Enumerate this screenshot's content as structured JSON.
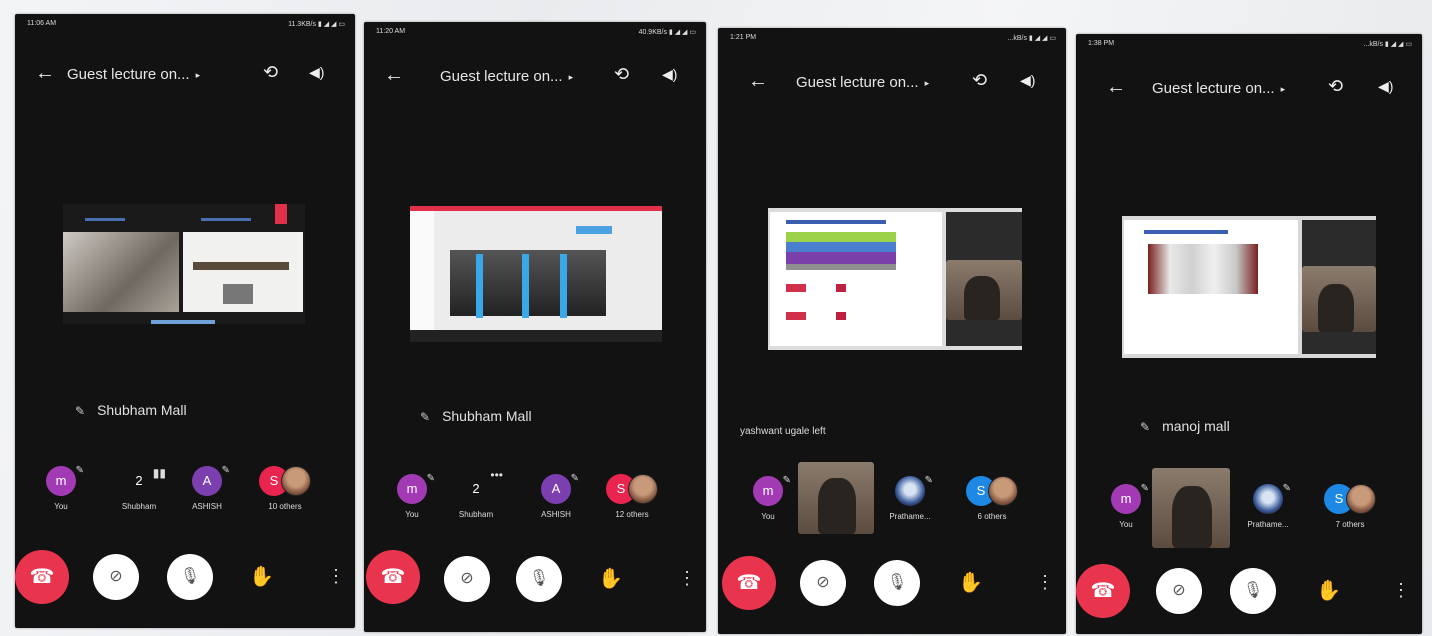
{
  "colors": {
    "end_call": "#e8344c",
    "avatar_m": "#a23bb3",
    "avatar_a": "#7b3fb0",
    "avatar_s": "#e8244f",
    "avatar_blue": "#1e88e5",
    "background": "#121213"
  },
  "phones": [
    {
      "status": {
        "time": "11:06 AM",
        "signal": "11.3KB/s ▮ ◢ ◢ ▭"
      },
      "header": {
        "back_icon": "←",
        "title": "Guest lecture on...",
        "caret": "▸",
        "switch_icon": "⟲",
        "speaker_icon": "◀)"
      },
      "speaker_name": "Shubham Mall",
      "participants": [
        {
          "initial": "m",
          "label": "You"
        },
        {
          "initial": "2",
          "label": "Shubham"
        },
        {
          "initial": "A",
          "label": "ASHISH"
        },
        {
          "initial": "S",
          "label": "10 others"
        }
      ]
    },
    {
      "status": {
        "time": "11:20 AM",
        "signal": "40.9KB/s ▮ ◢ ◢ ▭"
      },
      "header": {
        "back_icon": "←",
        "title": "Guest lecture on...",
        "caret": "▸",
        "switch_icon": "⟲",
        "speaker_icon": "◀)"
      },
      "speaker_name": "Shubham Mall",
      "participants": [
        {
          "initial": "m",
          "label": "You"
        },
        {
          "initial": "2",
          "label": "Shubham"
        },
        {
          "initial": "A",
          "label": "ASHISH"
        },
        {
          "initial": "S",
          "label": "12 others"
        }
      ]
    },
    {
      "status": {
        "time": "1:21 PM",
        "signal": "...kB/s ▮ ◢ ◢ ▭"
      },
      "header": {
        "back_icon": "←",
        "title": "Guest lecture on...",
        "caret": "▸",
        "switch_icon": "⟲",
        "speaker_icon": "◀)"
      },
      "left_message": "yashwant ugale left",
      "participants": [
        {
          "initial": "m",
          "label": "You"
        },
        {
          "initial": "",
          "label": ""
        },
        {
          "initial": "",
          "label": "Prathame..."
        },
        {
          "initial": "S",
          "label": "6 others"
        }
      ]
    },
    {
      "status": {
        "time": "1:38 PM",
        "signal": "...kB/s ▮ ◢ ◢ ▭"
      },
      "header": {
        "back_icon": "←",
        "title": "Guest lecture on...",
        "caret": "▸",
        "switch_icon": "⟲",
        "speaker_icon": "◀)"
      },
      "speaker_name": "manoj mall",
      "participants": [
        {
          "initial": "m",
          "label": "You"
        },
        {
          "initial": "",
          "label": ""
        },
        {
          "initial": "",
          "label": "Prathame..."
        },
        {
          "initial": "S",
          "label": "7 others"
        }
      ]
    }
  ],
  "controls": {
    "end_icon": "☎",
    "camera_off_icon": "⊘",
    "mic_off_icon": "🎙",
    "hand_icon": "✋",
    "more_icon": "⋮",
    "muted_mic_icon": "✎"
  }
}
